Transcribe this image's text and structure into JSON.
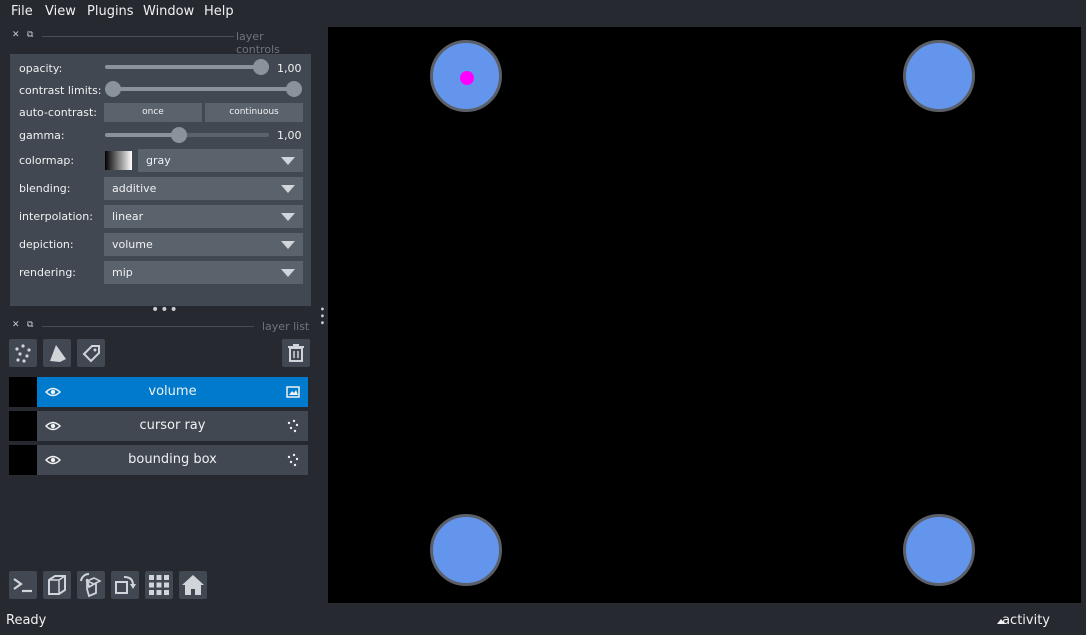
{
  "menu": {
    "file": "File",
    "view": "View",
    "plugins": "Plugins",
    "window": "Window",
    "help": "Help"
  },
  "layer_controls": {
    "title": "layer controls",
    "opacity": {
      "label": "opacity:",
      "value": "1,00",
      "level": 1.0
    },
    "contrast_limits": {
      "label": "contrast limits:",
      "range": [
        0.0,
        1.0
      ]
    },
    "auto_contrast": {
      "label": "auto-contrast:",
      "once": "once",
      "continuous": "continuous"
    },
    "gamma": {
      "label": "gamma:",
      "value": "1,00",
      "level": 0.5
    },
    "colormap": {
      "label": "colormap:",
      "value": "gray"
    },
    "blending": {
      "label": "blending:",
      "value": "additive"
    },
    "interpolation": {
      "label": "interpolation:",
      "value": "linear"
    },
    "depiction": {
      "label": "depiction:",
      "value": "volume"
    },
    "rendering": {
      "label": "rendering:",
      "value": "mip"
    }
  },
  "layer_list": {
    "title": "layer list",
    "layers": [
      {
        "name": "volume",
        "selected": true,
        "type_icon": "image-icon"
      },
      {
        "name": "cursor ray",
        "selected": false,
        "type_icon": "points-icon"
      },
      {
        "name": "bounding box",
        "selected": false,
        "type_icon": "points-icon"
      }
    ]
  },
  "colors": {
    "point_face": "#6495ed",
    "cursor": "#ff00ff",
    "selected_layer": "#007acc"
  },
  "status": {
    "text": "Ready",
    "activity": "activity"
  }
}
